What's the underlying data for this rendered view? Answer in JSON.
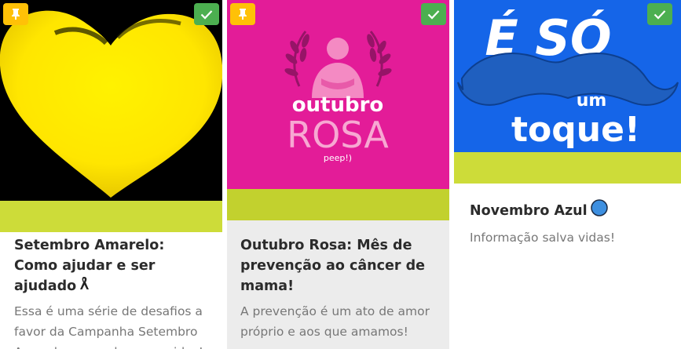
{
  "colors": {
    "accent_bar": "#cddc39",
    "pin_badge": "#ffc107",
    "check_badge": "#4caf50",
    "card1_bg": "#000000",
    "heart_yellow": "#ffeb00",
    "card2_bg": "#e31c98",
    "card2_body": "#ececec",
    "card3_bg": "#1565e8",
    "mustache": "#1f5fbf",
    "blue_dot": "#3d8fe0"
  },
  "cards": [
    {
      "title": "Setembro Amarelo: Como ajudar e ser ajudado",
      "title_icon": "awareness-ribbon-icon",
      "description": "Essa é uma série de desafios a favor da Campanha Setembro Amarelo para salvarmos vidas!",
      "pinned": true,
      "checked": true,
      "image": "yellow-heart-image"
    },
    {
      "title": "Outubro Rosa: Mês de prevenção ao câncer de mama!",
      "description": "A prevenção é um ato de amor próprio e aos que amamos!",
      "pinned": true,
      "checked": true,
      "image": "outubro-rosa-image",
      "image_text": {
        "line1": "outubro",
        "line2": "ROSA",
        "brand": "peep!)"
      }
    },
    {
      "title": "Novembro Azul",
      "title_icon": "blue-circle-icon",
      "description": "Informação salva vidas!",
      "pinned": false,
      "checked": true,
      "image": "mustache-image",
      "image_text": {
        "line1": "É SÓ",
        "line2": "um",
        "line3": "toque!"
      }
    }
  ]
}
